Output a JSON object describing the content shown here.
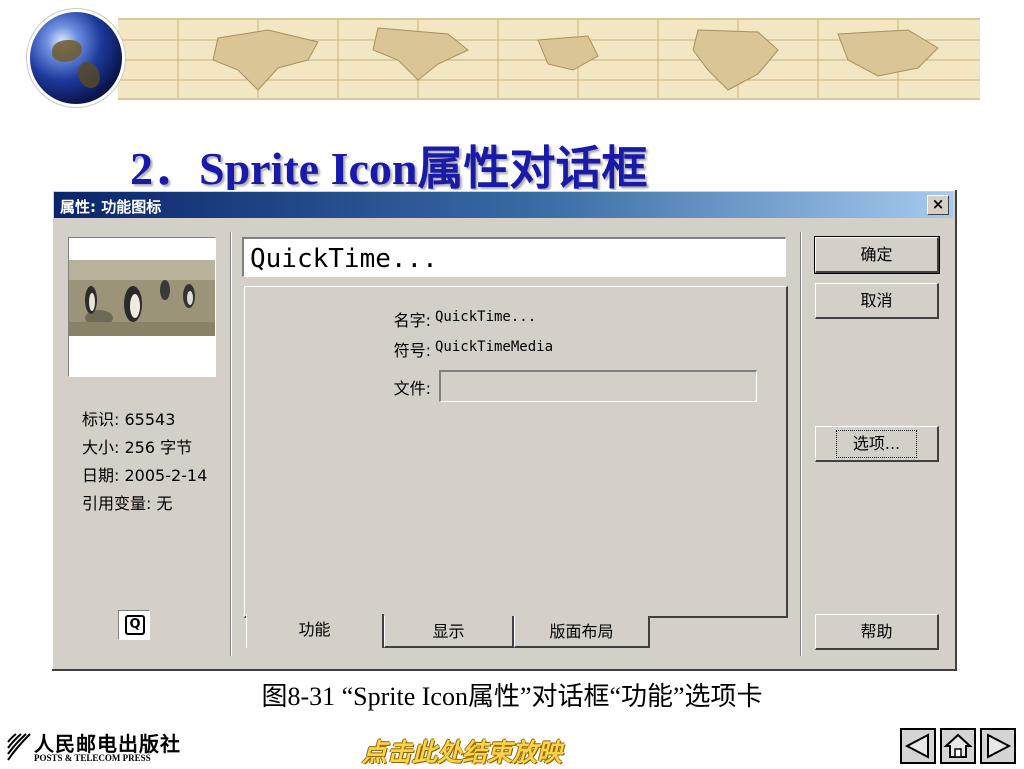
{
  "slide": {
    "title": "2．Sprite Icon属性对话框",
    "caption": "图8-31  “Sprite Icon属性”对话框“功能”选项卡",
    "end_show_link": "点击此处结束放映"
  },
  "publisher": {
    "name_cn": "人民邮电出版社",
    "name_en": "POSTS & TELECOM PRESS"
  },
  "dialog": {
    "title": "属性: 功能图标",
    "close_label": "×",
    "info": {
      "id": "标识: 65543",
      "size": "大小: 256 字节",
      "date": "日期: 2005-2-14",
      "refs": "引用变量: 无"
    },
    "small_icon_glyph": "Q",
    "name_value": "QuickTime...",
    "properties": {
      "name_label": "名字:",
      "name_value": "QuickTime...",
      "symbol_label": "符号:",
      "symbol_value": "QuickTimeMedia",
      "file_label": "文件:",
      "file_value": ""
    },
    "tabs": [
      "功能",
      "显示",
      "版面布局"
    ],
    "active_tab": "功能",
    "buttons": {
      "ok": "确定",
      "cancel": "取消",
      "options": "选项...",
      "help": "帮助"
    }
  },
  "colors": {
    "title": "#1a1aa8",
    "titlebar_start": "#0a246a",
    "titlebar_end": "#a6caf0",
    "dialog_face": "#d4d0c8",
    "end_link": "#ffd24a"
  },
  "icons": [
    "globe-icon",
    "world-map-banner",
    "close-icon",
    "quicktime-icon",
    "publisher-logo-icon",
    "prev-slide-icon",
    "home-icon",
    "next-slide-icon"
  ]
}
